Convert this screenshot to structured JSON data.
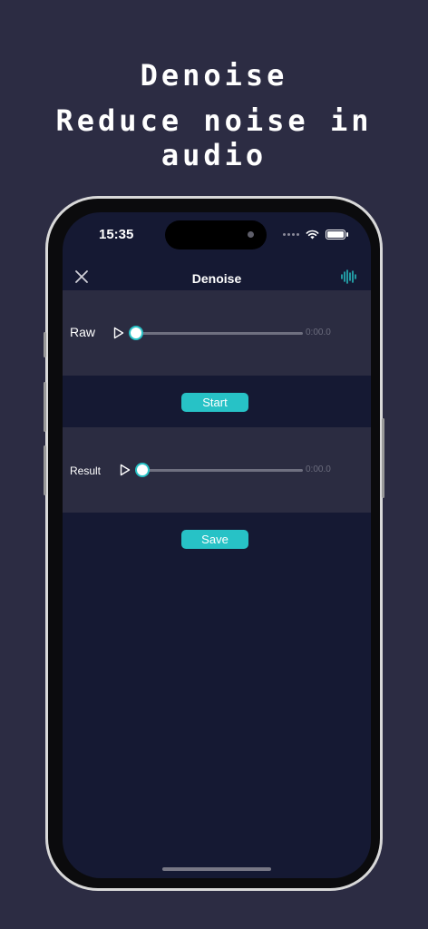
{
  "promo": {
    "title": "Denoise",
    "subtitle": "Reduce noise in audio"
  },
  "status_bar": {
    "time": "15:35"
  },
  "navbar": {
    "title": "Denoise",
    "left_icon": "close-icon",
    "right_icon": "waveform-icon"
  },
  "raw": {
    "label": "Raw",
    "time": "0:00.0",
    "progress": 0
  },
  "start_label": "Start",
  "result": {
    "label": "Result",
    "time": "0:00.0",
    "progress": 0
  },
  "save_label": "Save",
  "colors": {
    "background": "#2c2c43",
    "screen": "#151933",
    "panel": "#2b2c41",
    "accent": "#27c2c6"
  }
}
